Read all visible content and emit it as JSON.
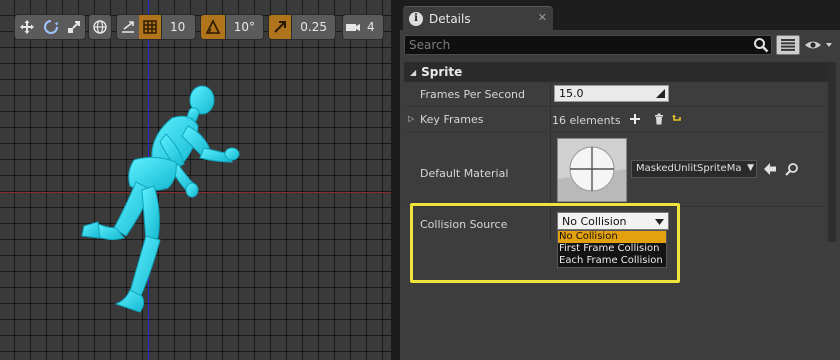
{
  "viewport": {
    "toolbar": {
      "grid_snap_value": "10",
      "rotation_snap_value": "10°",
      "scale_snap_value": "0.25",
      "camera_speed_value": "4"
    }
  },
  "details": {
    "tab": {
      "icon": "info-icon",
      "label": "Details",
      "close": "✕"
    },
    "search": {
      "placeholder": "Search",
      "value": ""
    },
    "category": {
      "label": "Sprite"
    },
    "properties": {
      "frames_per_second": {
        "label": "Frames Per Second",
        "value": "15.0"
      },
      "key_frames": {
        "label": "Key Frames",
        "count": "16 elements"
      },
      "default_material": {
        "label": "Default Material",
        "value": "MaskedUnlitSpriteMa"
      },
      "collision_source": {
        "label": "Collision Source",
        "value": "No Collision",
        "options": [
          "No Collision",
          "First Frame Collision",
          "Each Frame Collision"
        ],
        "selected_index": 0
      }
    }
  },
  "colors": {
    "accent_orange": "#b0741d",
    "menu_selected": "#e3a00f",
    "highlight_yellow": "#f0e43a",
    "mannequin_cyan": "#27d5e8",
    "axis_blue": "#1e2ad8",
    "axis_red": "#8a2a2a"
  }
}
